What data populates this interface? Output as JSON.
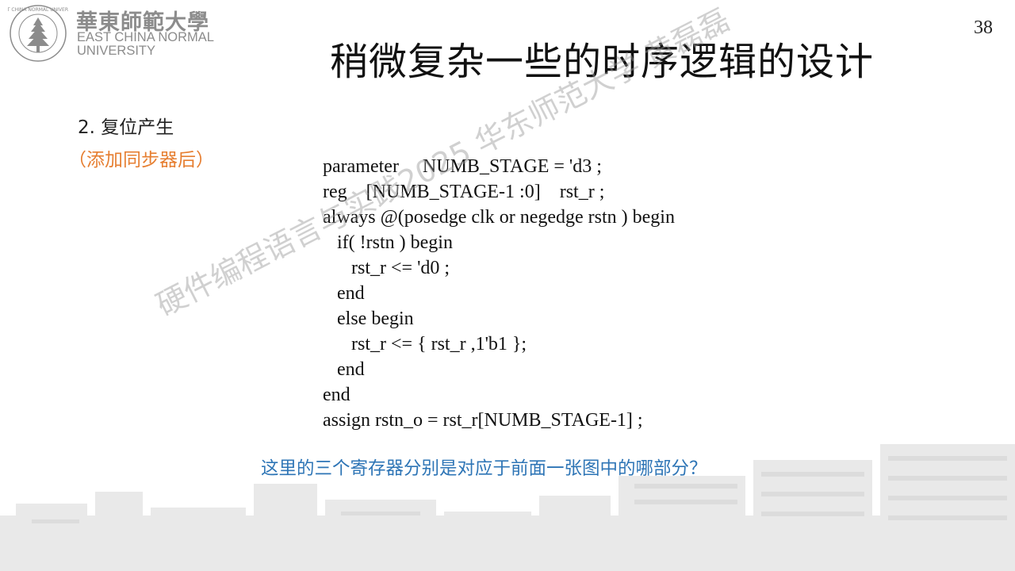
{
  "logo": {
    "cn": "華東師範大學",
    "en_line1": "EAST CHINA NORMAL",
    "en_line2": "UNIVERSITY",
    "seal_text": "EAST CHINA NORMAL UNIVERSITY"
  },
  "page_number": "38",
  "title": "稍微复杂一些的时序逻辑的设计",
  "section": {
    "label": "2. 复位产生",
    "note": "（添加同步器后）"
  },
  "code": [
    "parameter     NUMB_STAGE = 'd3 ;",
    "reg    [NUMB_STAGE-1 :0]    rst_r ;",
    "always @(posedge clk or negedge rstn ) begin",
    "   if( !rstn ) begin",
    "      rst_r <= 'd0 ;",
    "   end",
    "   else begin",
    "      rst_r <= { rst_r ,1'b1 };",
    "   end",
    "end",
    "assign rstn_o = rst_r[NUMB_STAGE-1] ;"
  ],
  "question": "这里的三个寄存器分别是对应于前面一张图中的哪部分？",
  "watermark": "硬件编程语言与实践2025 华东师范大学 黄磊磊"
}
